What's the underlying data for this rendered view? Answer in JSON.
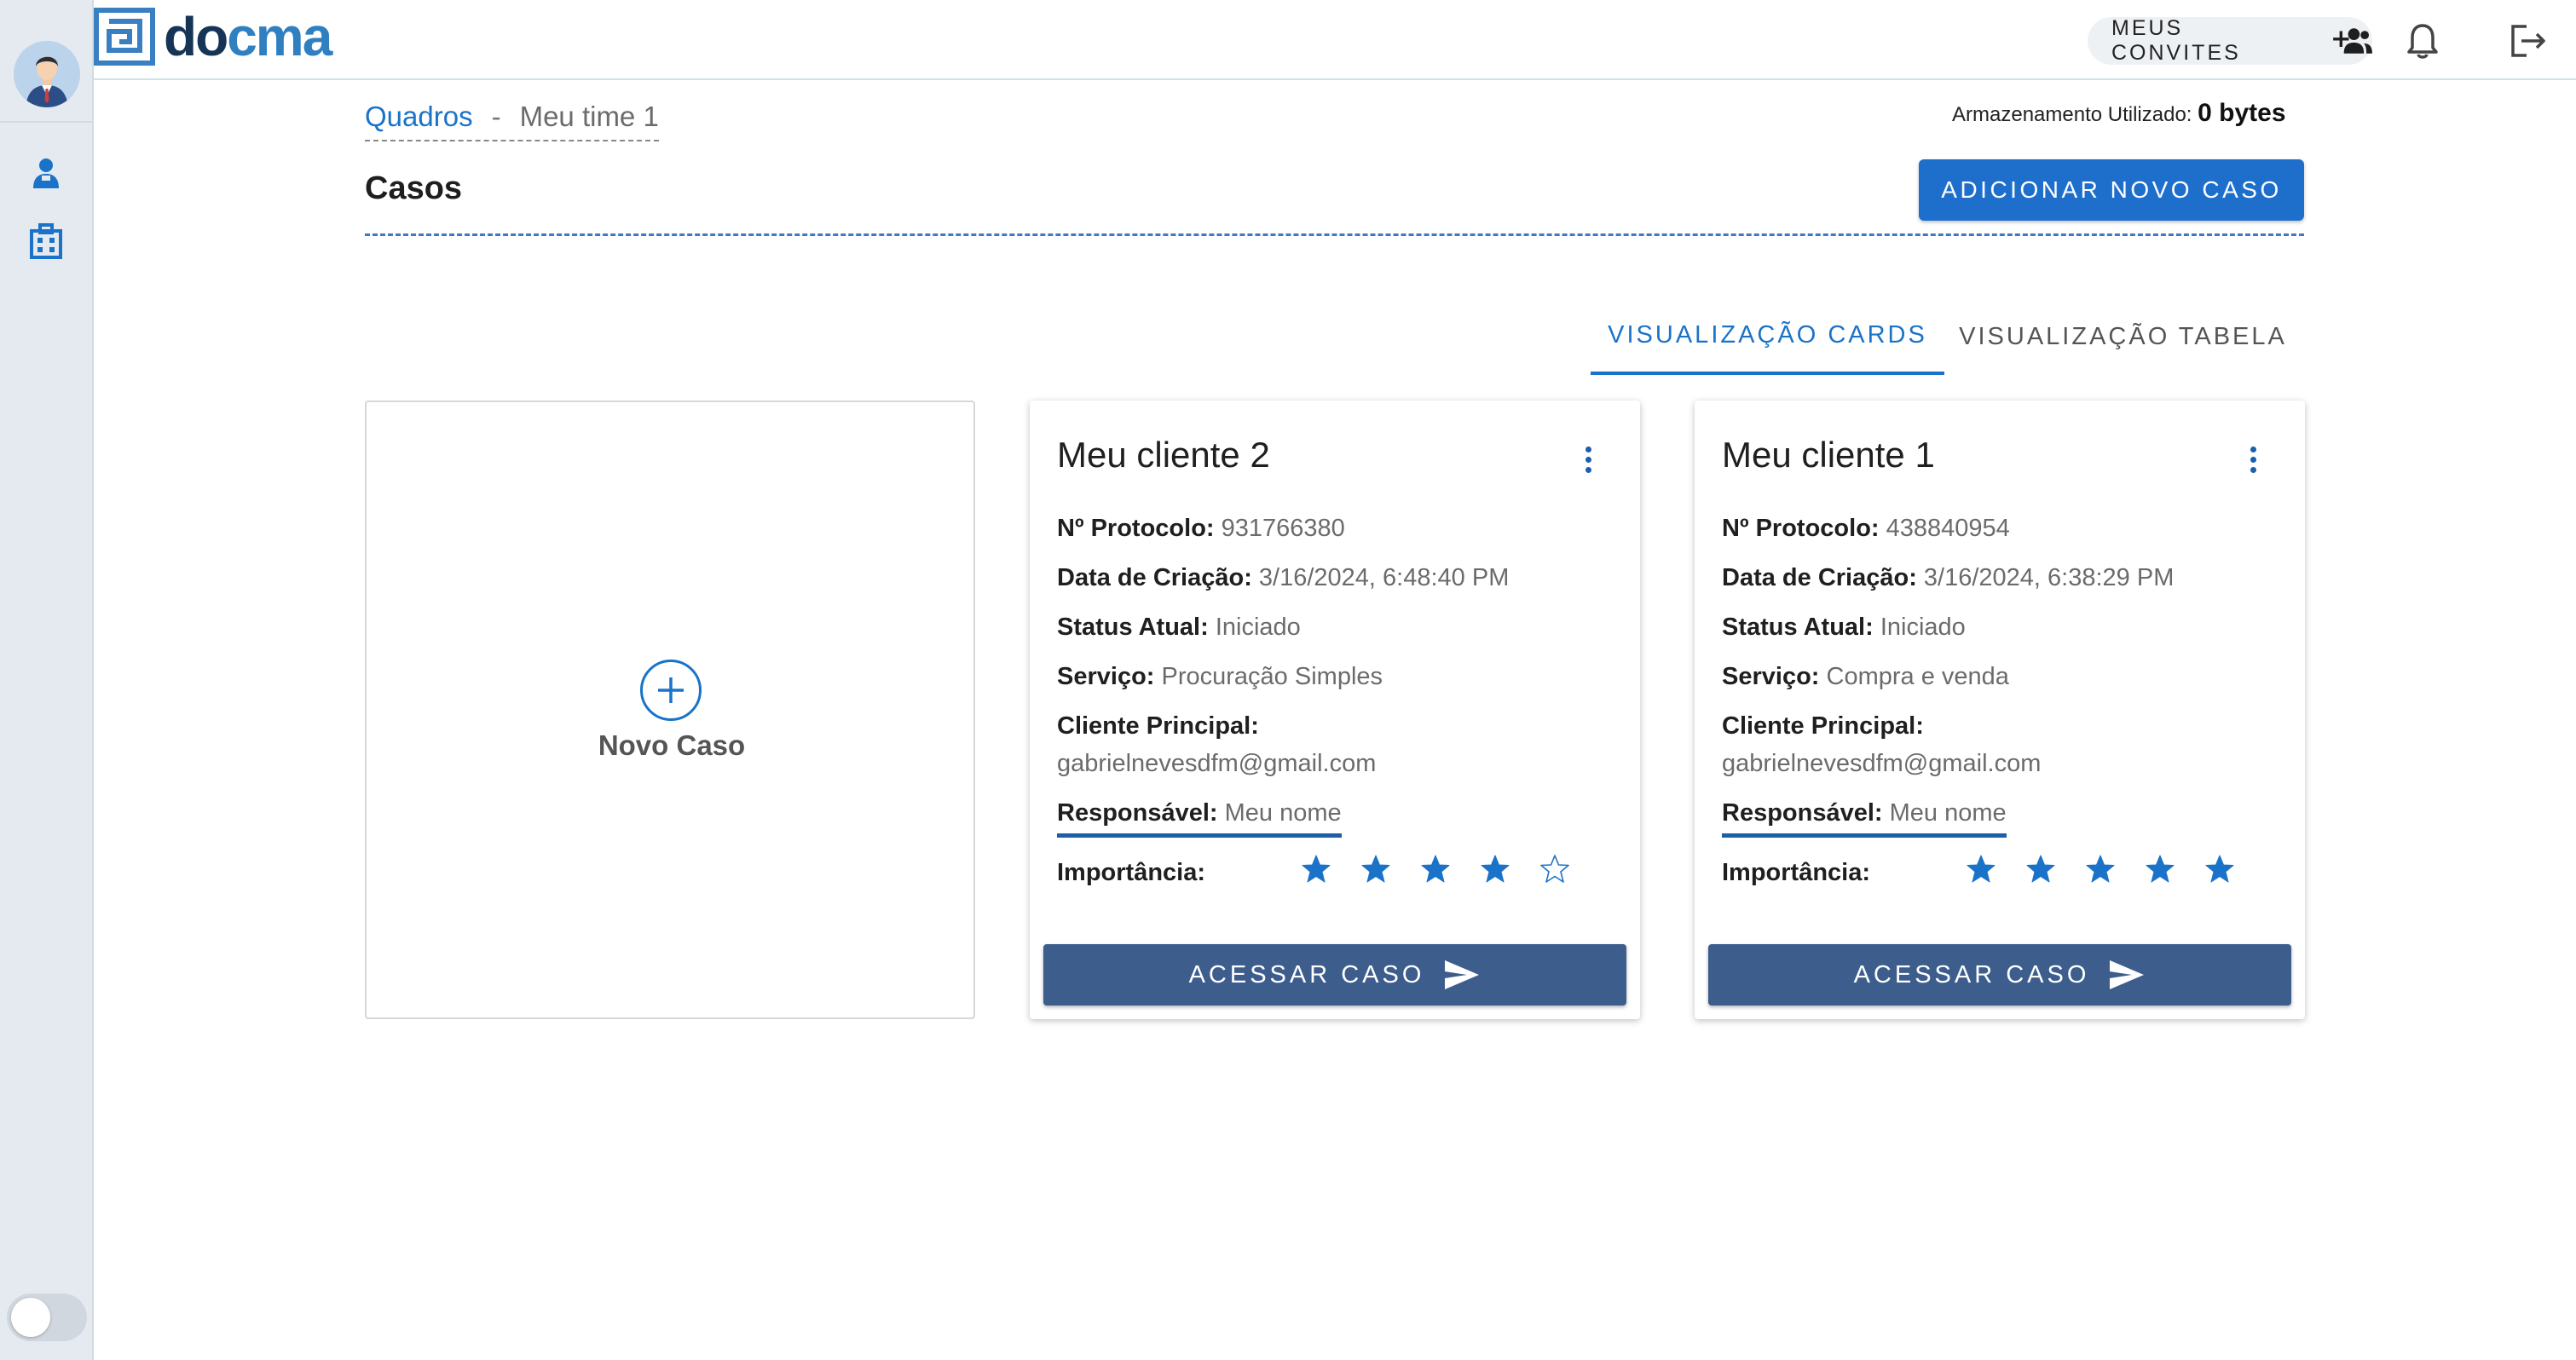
{
  "header": {
    "logo_text_prefix": "d",
    "logo_text_o": "o",
    "logo_text_suffix": "cma",
    "invites_label": "MEUS CONVITES"
  },
  "breadcrumb": {
    "link": "Quadros",
    "separator": "-",
    "current": "Meu time 1"
  },
  "storage": {
    "label": "Armazenamento Utilizado:",
    "value": "0 bytes"
  },
  "page": {
    "title": "Casos",
    "add_button": "ADICIONAR NOVO CASO"
  },
  "tabs": [
    {
      "label": "VISUALIZAÇÃO CARDS",
      "active": true
    },
    {
      "label": "VISUALIZAÇÃO TABELA",
      "active": false
    }
  ],
  "new_case": {
    "label": "Novo Caso"
  },
  "labels": {
    "protocol": "Nº Protocolo:",
    "created": "Data de Criação:",
    "status": "Status Atual:",
    "service": "Serviço:",
    "client": "Cliente Principal:",
    "responsible": "Responsável:",
    "importance": "Importância:",
    "access_button": "ACESSAR CASO"
  },
  "cases": [
    {
      "title": "Meu cliente 2",
      "protocol": "931766380",
      "created": "3/16/2024, 6:48:40 PM",
      "status": "Iniciado",
      "service": "Procuração Simples",
      "client": "gabrielnevesdfm@gmail.com",
      "responsible": "Meu nome",
      "importance": 4,
      "importance_max": 5
    },
    {
      "title": "Meu cliente 1",
      "protocol": "438840954",
      "created": "3/16/2024, 6:38:29 PM",
      "status": "Iniciado",
      "service": "Compra e venda",
      "client": "gabrielnevesdfm@gmail.com",
      "responsible": "Meu nome",
      "importance": 5,
      "importance_max": 5
    }
  ],
  "colors": {
    "accent": "#1a73c8",
    "brand_dark": "#163556",
    "button_dark": "#3d5e8d",
    "sidebar_bg": "#e4eaef"
  }
}
